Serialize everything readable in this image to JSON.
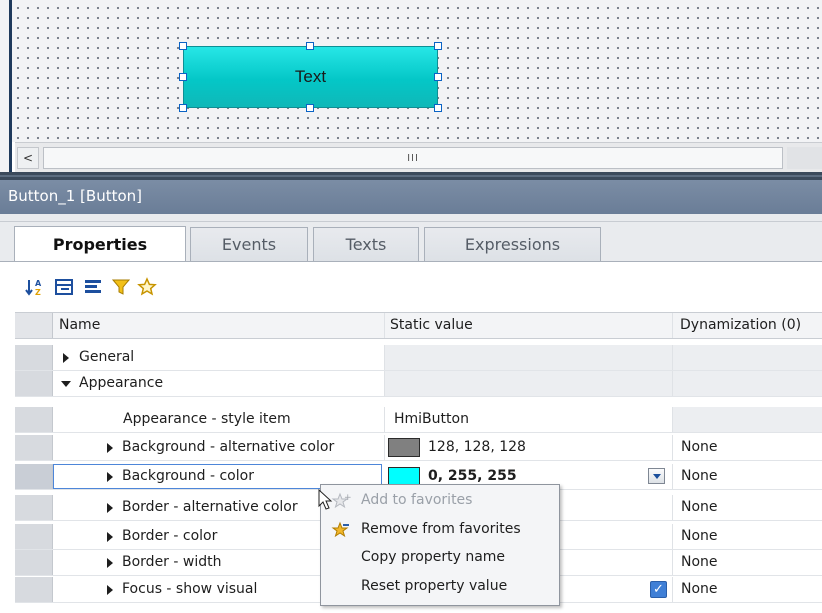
{
  "canvas": {
    "button_text": "Text",
    "button_color": "#00d8d8"
  },
  "scrollbar": {
    "left_arrow": "<",
    "thumb_grip": "III"
  },
  "panel": {
    "title": "Button_1 [Button]"
  },
  "tabs": [
    {
      "label": "Properties",
      "active": true
    },
    {
      "label": "Events",
      "active": false
    },
    {
      "label": "Texts",
      "active": false
    },
    {
      "label": "Expressions",
      "active": false
    }
  ],
  "toolbar": {
    "icons": [
      "sort-az-icon",
      "group-view-icon",
      "list-view-icon",
      "filter-icon",
      "favorites-star-icon"
    ]
  },
  "grid": {
    "headers": {
      "name": "Name",
      "static_value": "Static value",
      "dynamization": "Dynamization (0)"
    },
    "rows": [
      {
        "name": "General",
        "expander": "right",
        "value": "",
        "dyn": ""
      },
      {
        "name": "Appearance",
        "expander": "down",
        "value": "",
        "dyn": ""
      },
      {
        "name": "Appearance - style item",
        "expander": "",
        "value": "HmiButton",
        "dyn": ""
      },
      {
        "name": "Background - alternative color",
        "expander": "right",
        "value": "128, 128, 128",
        "swatch": "#808080",
        "dyn": "None"
      },
      {
        "name": "Background - color",
        "expander": "right",
        "value": "0, 255, 255",
        "swatch": "#00ffff",
        "dyn": "None"
      },
      {
        "name": "Border - alternative color",
        "expander": "right",
        "value": "",
        "dyn": "None"
      },
      {
        "name": "Border - color",
        "expander": "right",
        "value": "",
        "dyn": "None"
      },
      {
        "name": "Border - width",
        "expander": "right",
        "value": "",
        "dyn": "None"
      },
      {
        "name": "Focus - show visual",
        "expander": "right",
        "value": "",
        "checked": true,
        "dyn": "None"
      }
    ]
  },
  "context_menu": {
    "items": [
      {
        "label": "Add to favorites",
        "enabled": false,
        "icon": "add-favorite-icon"
      },
      {
        "label": "Remove from favorites",
        "enabled": true,
        "icon": "remove-favorite-icon"
      },
      {
        "label": "Copy property name",
        "enabled": true,
        "icon": ""
      },
      {
        "label": "Reset property value",
        "enabled": true,
        "icon": ""
      }
    ]
  }
}
